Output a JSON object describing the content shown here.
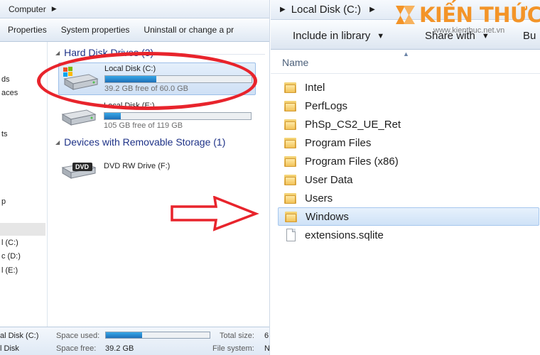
{
  "left": {
    "address": {
      "crumb": "Computer"
    },
    "commands": [
      "Properties",
      "System properties",
      "Uninstall or change a pr"
    ],
    "nav_fragments": [
      "ds",
      "aces",
      "ts",
      "p",
      "l (C:)",
      "c (D:)",
      "l (E:)"
    ],
    "groups": {
      "hard_disks": "Hard Disk Drives (3)",
      "removable": "Devices with Removable Storage (1)"
    },
    "drives": [
      {
        "name": "Local Disk (C:)",
        "free_text": "39.2 GB free of 60.0 GB",
        "used_fraction": 0.35
      },
      {
        "name": "Local Disk (E:)",
        "free_text": "105 GB free of 119 GB",
        "used_fraction": 0.11
      }
    ],
    "dvd": {
      "name": "DVD RW Drive (F:)",
      "badge": "DVD"
    },
    "details": {
      "title": "al Disk (C:)",
      "type": "l Disk",
      "space_used_label": "Space used:",
      "space_used_fraction": 0.35,
      "space_free_label": "Space free:",
      "space_free_value": "39.2 GB",
      "total_size_label": "Total size:",
      "total_size_value": "6",
      "file_system_label": "File system:",
      "file_system_value": "N"
    }
  },
  "right": {
    "address": {
      "crumb": "Local Disk (C:)"
    },
    "commands": {
      "include": "Include in library",
      "share": "Share with",
      "burn": "Bu"
    },
    "column": "Name",
    "files": [
      {
        "name": "Intel",
        "type": "folder"
      },
      {
        "name": "PerfLogs",
        "type": "folder"
      },
      {
        "name": "PhSp_CS2_UE_Ret",
        "type": "folder"
      },
      {
        "name": "Program Files",
        "type": "folder"
      },
      {
        "name": "Program Files (x86)",
        "type": "folder"
      },
      {
        "name": "User Data",
        "type": "folder"
      },
      {
        "name": "Users",
        "type": "folder"
      },
      {
        "name": "Windows",
        "type": "folder",
        "selected": true
      },
      {
        "name": "extensions.sqlite",
        "type": "file"
      }
    ]
  },
  "logo": {
    "brand": "KIẾN THỨC",
    "url": "www.kienthuc.net.vn",
    "color": "#f39428"
  },
  "annotation": {
    "ellipse_color": "#e8242c",
    "arrow_color": "#e8242c"
  }
}
